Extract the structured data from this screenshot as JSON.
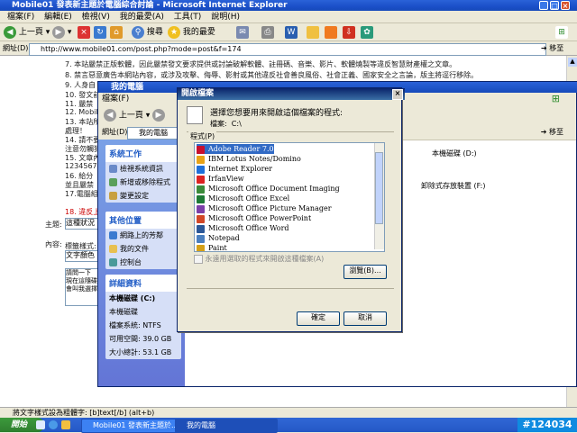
{
  "ie": {
    "title": "Mobile01 發表新主題於電腦綜合討論 - Microsoft Internet Explorer",
    "menu": [
      "檔案(F)",
      "編輯(E)",
      "檢視(V)",
      "我的最愛(A)",
      "工具(T)",
      "說明(H)"
    ],
    "toolbar": {
      "back": "上一頁",
      "search": "搜尋",
      "favorites": "我的最愛"
    },
    "address_label": "網址(D)",
    "address": "http://www.mobile01.com/post.php?mode=post&f=174",
    "go": "移至"
  },
  "page": {
    "lines": [
      "7. 本站嚴禁正版軟體，因此嚴禁發文要求提供或討論破解軟體、註冊碼、音樂、影片、軟體燒製等違反智慧財產權之文章。",
      "8. 禁言惡意廣告本網站內容，或涉及攻擊、侮辱、影射或其他違反社會善良風俗、社會正義、國家安全之言論，版主將逕行移除。",
      "9. 人身自",
      "10. 發文前",
      "11. 嚴禁",
      "12. Mobil",
      "13. 本站所",
      "處理！",
      "14. 請不要",
      "注意勿觸犯",
      "15. 文章內",
      "1234567",
      "16. 給分",
      "並且嚴禁",
      "17.電腦組",
      "18. 違反上"
    ],
    "subject_label": "主題:",
    "subject_value": "這種狀況",
    "content_label": "內容:",
    "style_label": "標籤樣式:",
    "color_label": "文字顏色",
    "textarea": [
      "請問一下",
      "現在這隨碟",
      "會叫我選擇"
    ],
    "right_texts": [
      "本機磁碟 (D:)",
      "卸除式存放裝置 (F:)"
    ]
  },
  "mycomputer": {
    "title": "我的電腦",
    "menu": [
      "檔案(F)"
    ],
    "back": "上一頁",
    "address_label": "網址(D)",
    "address": "我的電腦",
    "go": "移至",
    "system_tasks": {
      "header": "系統工作",
      "items": [
        "檢視系統資訊",
        "新增或移除程式",
        "變更設定"
      ]
    },
    "other_places": {
      "header": "其他位置",
      "items": [
        "網路上的芳鄰",
        "我的文件",
        "控制台"
      ]
    },
    "details": {
      "header": "詳細資料",
      "name": "本機磁碟 (C:)",
      "kind": "本機磁碟",
      "fs": "檔案系統: NTFS",
      "free": "可用空間: 39.0 GB",
      "total": "大小總計: 53.1 GB"
    }
  },
  "dialog": {
    "title": "開啟檔案",
    "prompt": "選擇您想要用來開啟這個檔案的程式:",
    "file_label": "檔案:",
    "file": "C:\\",
    "programs_label": "程式(P)",
    "programs": [
      {
        "name": "Adobe Reader 7.0",
        "color": "#c8102e",
        "selected": true
      },
      {
        "name": "IBM Lotus Notes/Domino",
        "color": "#e8a317"
      },
      {
        "name": "Internet Explorer",
        "color": "#1e6fd9"
      },
      {
        "name": "IrfanView",
        "color": "#d22"
      },
      {
        "name": "Microsoft Office Document Imaging",
        "color": "#3a8a3a"
      },
      {
        "name": "Microsoft Office Excel",
        "color": "#1d7a35"
      },
      {
        "name": "Microsoft Office Picture Manager",
        "color": "#7b3fa8"
      },
      {
        "name": "Microsoft Office PowerPoint",
        "color": "#d24726"
      },
      {
        "name": "Microsoft Office Word",
        "color": "#2b5797"
      },
      {
        "name": "Notepad",
        "color": "#4a7fbf"
      },
      {
        "name": "Paint",
        "color": "#d4a017"
      }
    ],
    "always_use": "永遠用選取的程式來開啟這種檔案(A)",
    "browse": "瀏覽(B)...",
    "ok": "確定",
    "cancel": "取消"
  },
  "status": {
    "text": "將文字樣式設為粗體字: [b]text[/b] (alt+b)"
  },
  "taskbar": {
    "start": "開始",
    "tasks": [
      "Mobile01 發表新主題於...",
      "我的電腦"
    ],
    "tray": "#124034"
  }
}
